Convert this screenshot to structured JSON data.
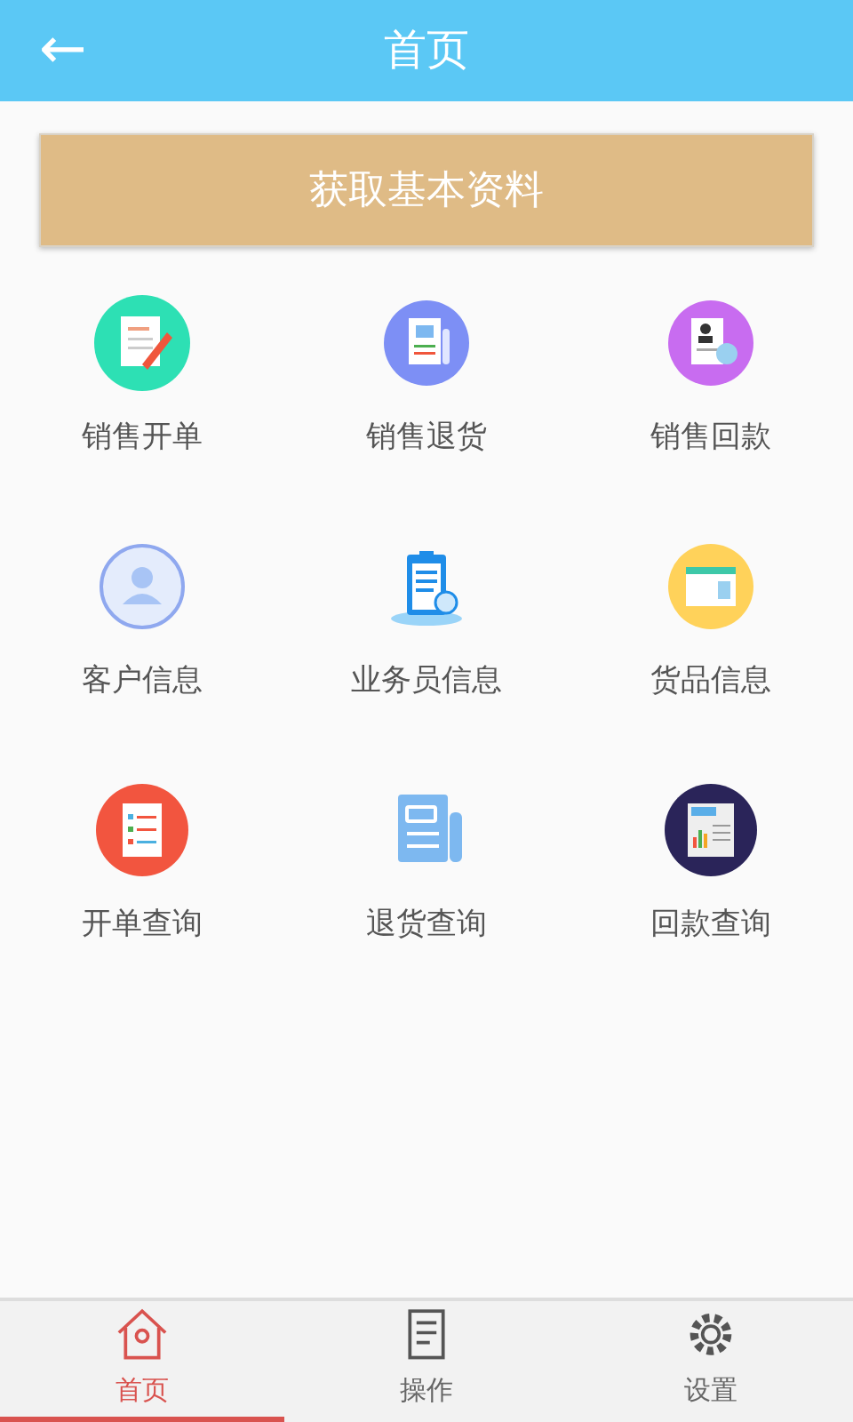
{
  "header": {
    "back": "←",
    "title": "首页"
  },
  "action_button": "获取基本资料",
  "menu": [
    {
      "label": "销售开单"
    },
    {
      "label": "销售退货"
    },
    {
      "label": "销售回款"
    },
    {
      "label": "客户信息"
    },
    {
      "label": "业务员信息"
    },
    {
      "label": "货品信息"
    },
    {
      "label": "开单查询"
    },
    {
      "label": "退货查询"
    },
    {
      "label": "回款查询"
    }
  ],
  "tab_bar": [
    {
      "label": "首页",
      "selected": true
    },
    {
      "label": "操作",
      "selected": false
    },
    {
      "label": "设置",
      "selected": false
    }
  ]
}
